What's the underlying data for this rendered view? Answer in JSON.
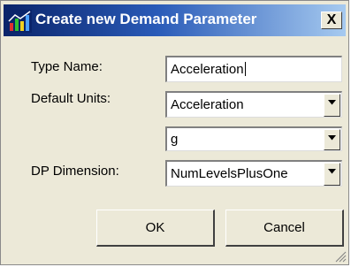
{
  "dialog": {
    "title": "Create new Demand Parameter",
    "close_label": "X"
  },
  "form": {
    "type_name_label": "Type Name:",
    "type_name_value": "Acceleration",
    "default_units_label": "Default Units:",
    "default_units_value": "Acceleration",
    "unit_value": "g",
    "dp_dimension_label": "DP Dimension:",
    "dp_dimension_value": "NumLevelsPlusOne"
  },
  "buttons": {
    "ok_label": "OK",
    "cancel_label": "Cancel"
  },
  "icons": {
    "app": "demand-parameter-app-icon",
    "close": "close-icon",
    "dropdown": "chevron-down-icon",
    "resize": "resize-grip-icon"
  },
  "colors": {
    "title_bar_start": "#0a246a",
    "title_bar_end": "#a6caf0",
    "dialog_bg": "#ece9d8"
  }
}
